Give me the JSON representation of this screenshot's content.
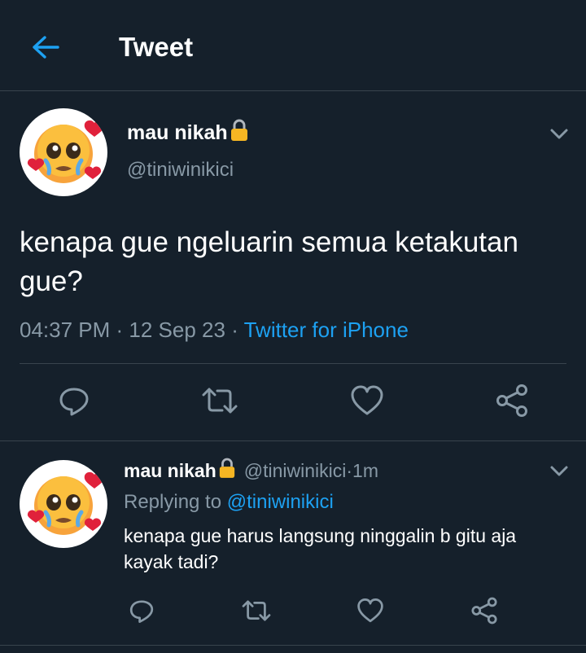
{
  "colors": {
    "background": "#15202b",
    "accent": "#1da1f2",
    "secondary_text": "#8899a6",
    "divider": "#38444d"
  },
  "header": {
    "back_icon": "arrow-left-icon",
    "title": "Tweet"
  },
  "main_tweet": {
    "name": "mau nikah",
    "lock_icon": "lock-icon",
    "handle": "@tiniwinikici",
    "text": "kenapa gue ngeluarin semua ketakutan gue?",
    "time": "04:37 PM",
    "separator1": " · ",
    "date": "12 Sep 23",
    "separator2": " · ",
    "source": "Twitter for iPhone",
    "actions": [
      "reply-icon",
      "retweet-icon",
      "like-icon",
      "share-icon"
    ]
  },
  "reply_tweet": {
    "name": "mau nikah",
    "handle": "@tiniwinikici",
    "separator": " · ",
    "age": "1m",
    "replying_label": "Replying to ",
    "replying_to": "@tiniwinikici",
    "text": "kenapa gue harus langsung ninggalin b gitu aja kayak tadi?",
    "actions": [
      "reply-icon",
      "retweet-icon",
      "like-icon",
      "share-icon"
    ]
  }
}
